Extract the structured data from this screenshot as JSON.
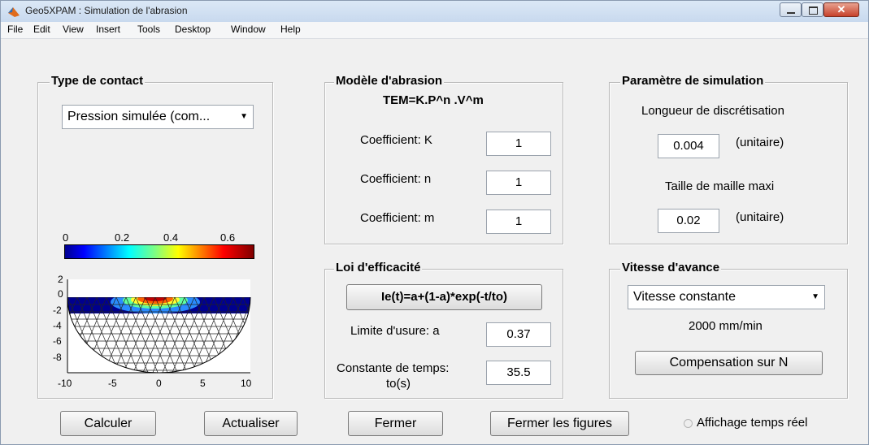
{
  "window": {
    "title": "Geo5XPAM : Simulation de l'abrasion",
    "menu": [
      "File",
      "Edit",
      "View",
      "Insert",
      "Tools",
      "Desktop",
      "Window",
      "Help"
    ]
  },
  "contact": {
    "title": "Type de contact",
    "select_value": "Pression simulée (com...",
    "colorbar_ticks": [
      "0",
      "0.2",
      "0.4",
      "0.6"
    ],
    "y_ticks": [
      "2",
      "0",
      "-2",
      "-4",
      "-6",
      "-8"
    ],
    "x_ticks": [
      "-10",
      "-5",
      "0",
      "5",
      "10"
    ]
  },
  "model": {
    "title": "Modèle d'abrasion",
    "formula": "TEM=K.P^n .V^m",
    "k_label": "Coefficient: K",
    "k_value": "1",
    "n_label": "Coefficient: n",
    "n_value": "1",
    "m_label": "Coefficient: m",
    "m_value": "1"
  },
  "simulation": {
    "title": "Paramètre de simulation",
    "length_label": "Longueur de discrétisation",
    "length_value": "0.004",
    "length_unit": "(unitaire)",
    "mesh_label": "Taille de maille maxi",
    "mesh_value": "0.02",
    "mesh_unit": "(unitaire)"
  },
  "efficiency": {
    "title": "Loi d'efficacité",
    "formula_button": "Ie(t)=a+(1-a)*exp(-t/to)",
    "limit_label": "Limite d'usure: a",
    "limit_value": "0.37",
    "time_label_1": "Constante de temps:",
    "time_label_2": "to(s)",
    "time_value": "35.5"
  },
  "speed": {
    "title": "Vitesse d'avance",
    "select_value": "Vitesse constante",
    "speed_text": "2000 mm/min",
    "compensation_button": "Compensation sur N"
  },
  "bottom": {
    "calculer": "Calculer",
    "actualiser": "Actualiser",
    "fermer": "Fermer",
    "fermer_figures": "Fermer les figures",
    "realtime_label": "Affichage temps réel"
  }
}
